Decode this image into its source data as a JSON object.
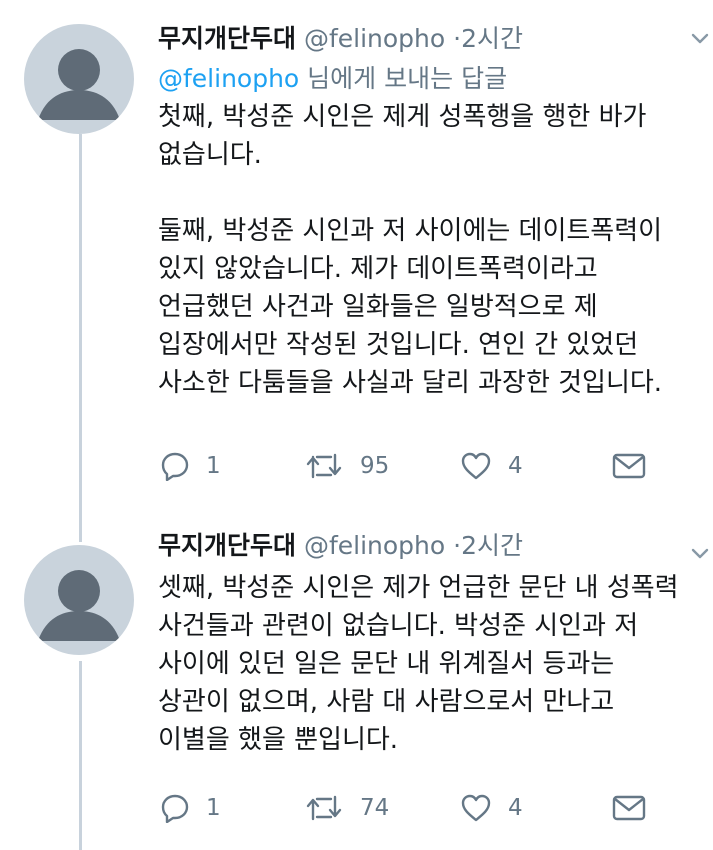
{
  "tweets": [
    {
      "author_name": "무지개단두대",
      "handle": "@felinopho",
      "separator": "·",
      "time": "2시간",
      "replying_handle": "@felinopho",
      "replying_suffix": " 님에게 보내는 답글",
      "text": "첫째, 박성준 시인은 제게 성폭행을 행한 바가\n없습니다.\n\n둘째, 박성준 시인과 저 사이에는 데이트폭력이\n있지 않았습니다. 제가 데이트폭력이라고\n언급했던 사건과 일화들은 일방적으로 제\n입장에서만 작성된 것입니다. 연인 간 있었던\n사소한 다툼들을 사실과 달리 과장한 것입니다.",
      "replies": "1",
      "retweets": "95",
      "likes": "4"
    },
    {
      "author_name": "무지개단두대",
      "handle": "@felinopho",
      "separator": "·",
      "time": "2시간",
      "text": "셋째, 박성준 시인은 제가 언급한 문단 내 성폭력\n사건들과 관련이 없습니다. 박성준 시인과 저\n사이에 있던 일은 문단 내 위계질서 등과는\n상관이 없으며, 사람 대 사람으로서 만나고\n이별을 했을 뿐입니다.",
      "replies": "1",
      "retweets": "74",
      "likes": "4"
    }
  ],
  "icons": {
    "reply": "reply-icon",
    "retweet": "retweet-icon",
    "like": "heart-icon",
    "dm": "envelope-icon",
    "caret": "chevron-down-icon",
    "avatar": "default-avatar"
  },
  "colors": {
    "link": "#1da1f2",
    "secondary_text": "#657786",
    "thread_line": "#c8d2dc",
    "avatar_bg": "#c9d3dc"
  }
}
